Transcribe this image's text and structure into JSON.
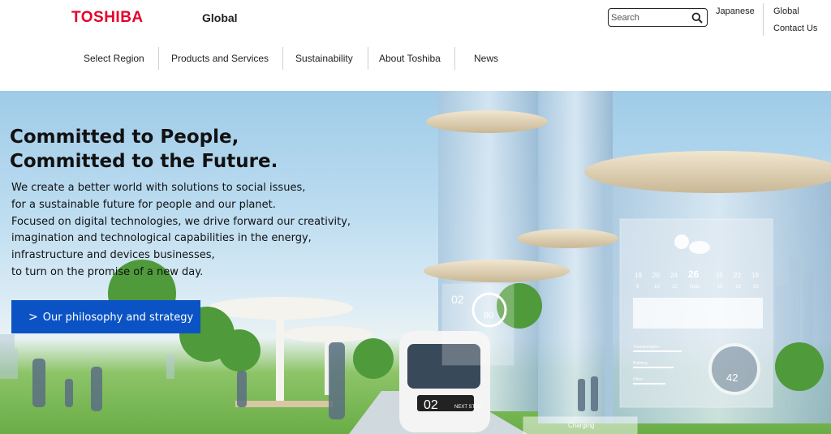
{
  "header": {
    "logo": "TOSHIBA",
    "site_label": "Global",
    "search": {
      "placeholder": "Search"
    },
    "utility": {
      "japanese": "Japanese",
      "global": "Global",
      "contact": "Contact Us"
    }
  },
  "nav": {
    "items": [
      "Select Region",
      "Products and Services",
      "Sustainability",
      "About Toshiba",
      "News"
    ]
  },
  "hero": {
    "title_lines": [
      "Committed to People,",
      "Committed to the Future."
    ],
    "body_lines": [
      "We create a better world with solutions to social issues,",
      "for a sustainable future for people and our planet.",
      "Focused on digital technologies, we drive forward our creativity,",
      "imagination and technological capabilities in the energy,",
      "infrastructure and devices businesses,",
      "to turn on the promise of a new day."
    ],
    "cta_label": "Our philosophy and strategy"
  },
  "hero_overlays": {
    "ar_number": "02",
    "ar_gauge": "80",
    "bus_number": "02",
    "bus_label": "NEXT STOP",
    "charging_label": "Charging",
    "weather_today_temp": "26",
    "weather_today_label": "Now",
    "weather_temps": [
      "19",
      "20",
      "24",
      "25",
      "22",
      "19"
    ],
    "weather_hours": [
      "8",
      "10",
      "12",
      "15",
      "19",
      "20"
    ],
    "weather_rows": [
      "Transportation",
      "Building",
      "Other"
    ],
    "weather_dial_value": "42"
  },
  "colors": {
    "brand_red": "#e4002b",
    "cta_blue": "#0b53c5"
  }
}
